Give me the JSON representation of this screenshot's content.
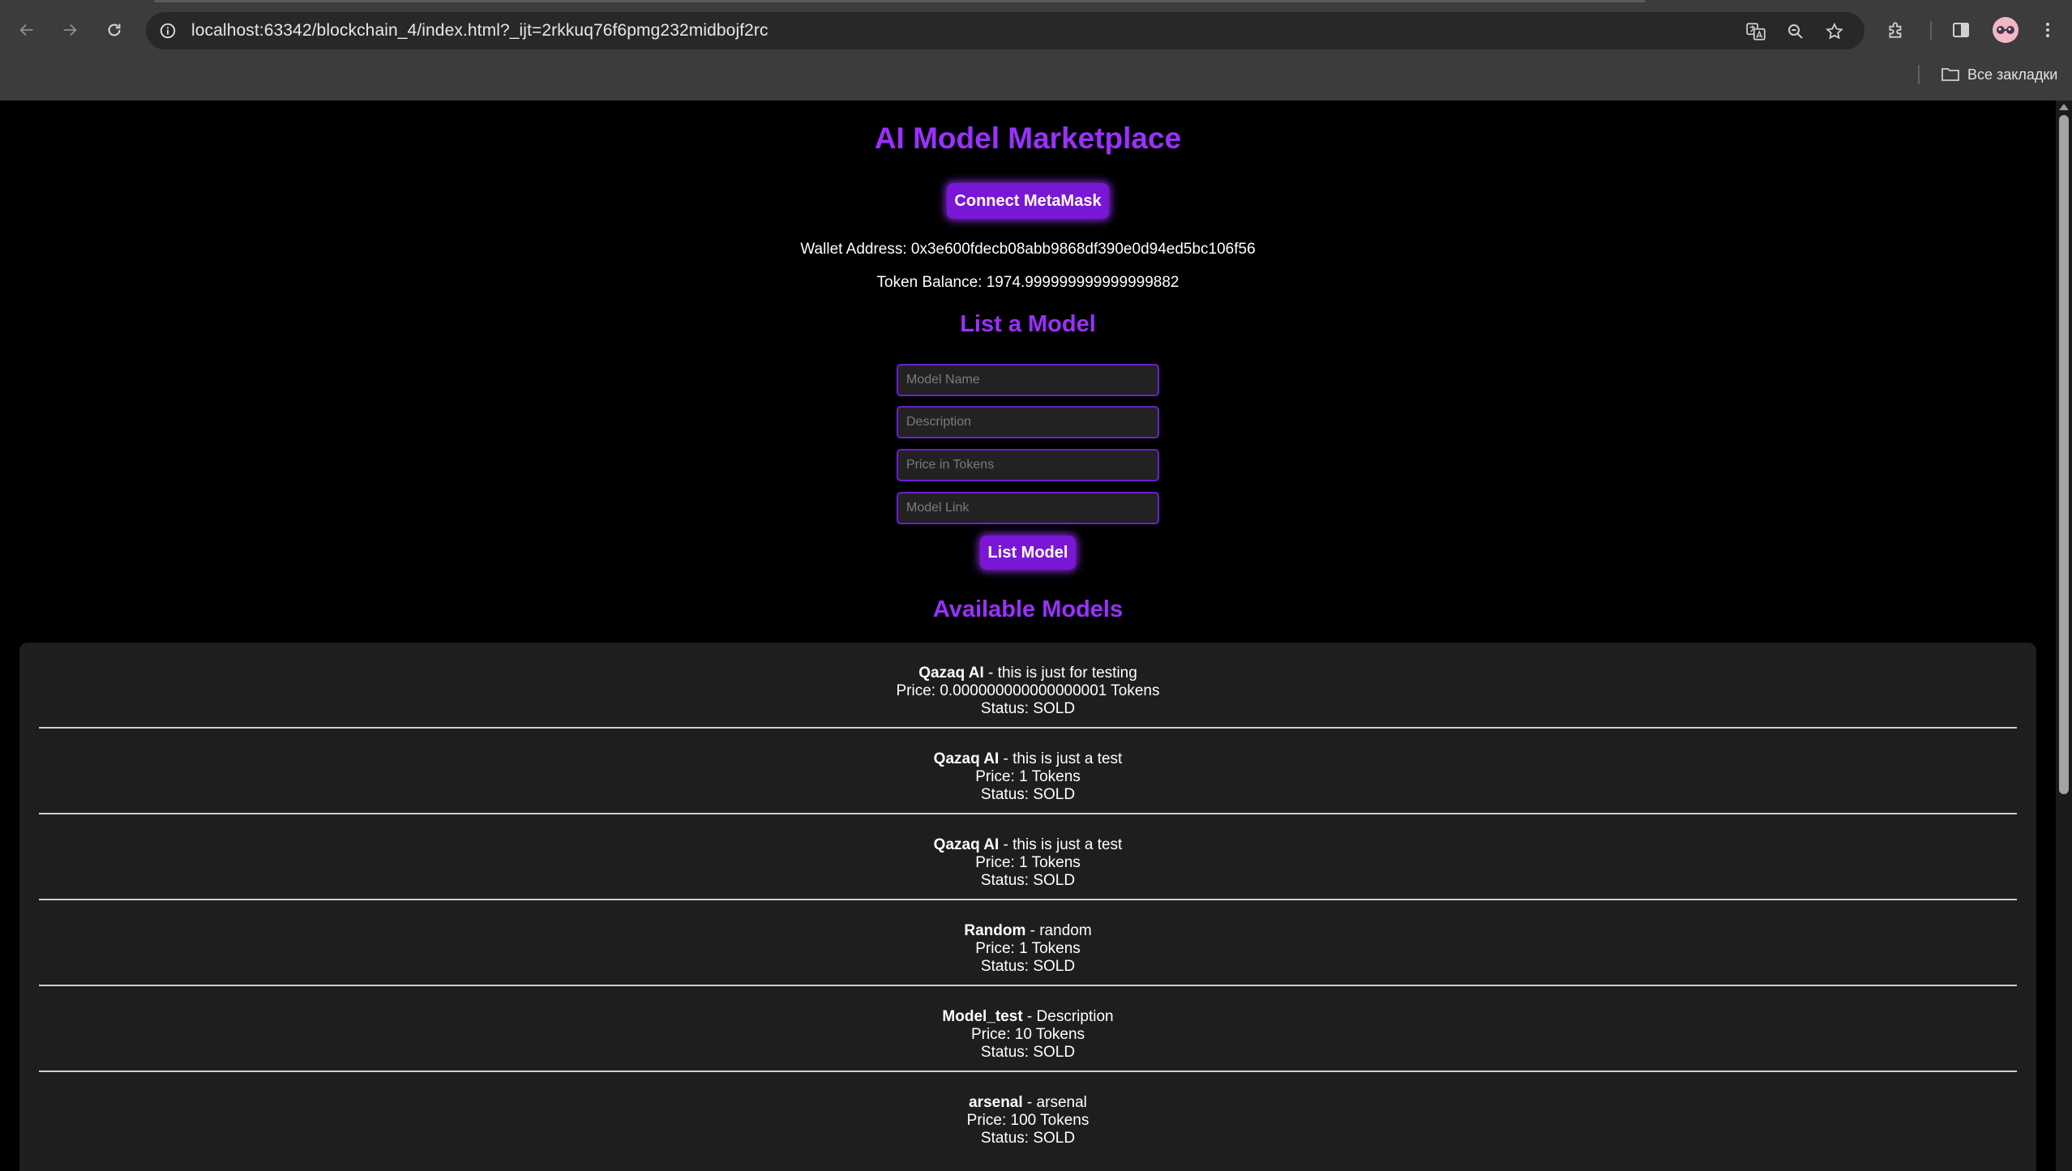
{
  "browser": {
    "url": "localhost:63342/blockchain_4/index.html?_ijt=2rkkuq76f6pmg232midbojf2rc",
    "bookmarks_label": "Все закладки"
  },
  "page": {
    "title": "AI Model Marketplace",
    "connect_button": "Connect MetaMask",
    "wallet_label": "Wallet Address:",
    "wallet_address": "0x3e600fdecb08abb9868df390e0d94ed5bc106f56",
    "balance_label": "Token Balance:",
    "balance_value": "1974.999999999999999882",
    "list_heading": "List a Model",
    "form": {
      "name_placeholder": "Model Name",
      "description_placeholder": "Description",
      "price_placeholder": "Price in Tokens",
      "link_placeholder": "Model Link",
      "submit_label": "List Model"
    },
    "available_heading": "Available Models",
    "models": [
      {
        "name": "Qazaq AI",
        "description": "this is just for testing",
        "price": "Price: 0.000000000000000001 Tokens",
        "status": "Status: SOLD"
      },
      {
        "name": "Qazaq AI",
        "description": "this is just a test",
        "price": "Price: 1 Tokens",
        "status": "Status: SOLD"
      },
      {
        "name": "Qazaq AI",
        "description": "this is just a test",
        "price": "Price: 1 Tokens",
        "status": "Status: SOLD"
      },
      {
        "name": "Random",
        "description": "random",
        "price": "Price: 1 Tokens",
        "status": "Status: SOLD"
      },
      {
        "name": "Model_test",
        "description": "Description",
        "price": "Price: 10 Tokens",
        "status": "Status: SOLD"
      },
      {
        "name": "arsenal",
        "description": "arsenal",
        "price": "Price: 100 Tokens",
        "status": "Status: SOLD"
      }
    ]
  },
  "colors": {
    "accent": "#9b30ff",
    "button": "#7a17d6",
    "background": "#000000",
    "panel": "#1e1e1e"
  },
  "icons": [
    "back-arrow-icon",
    "forward-arrow-icon",
    "reload-icon",
    "site-info-icon",
    "translate-icon",
    "zoom-icon",
    "star-icon",
    "extensions-icon",
    "side-panel-icon",
    "profile-avatar-icon",
    "menu-dots-icon",
    "folder-icon"
  ]
}
